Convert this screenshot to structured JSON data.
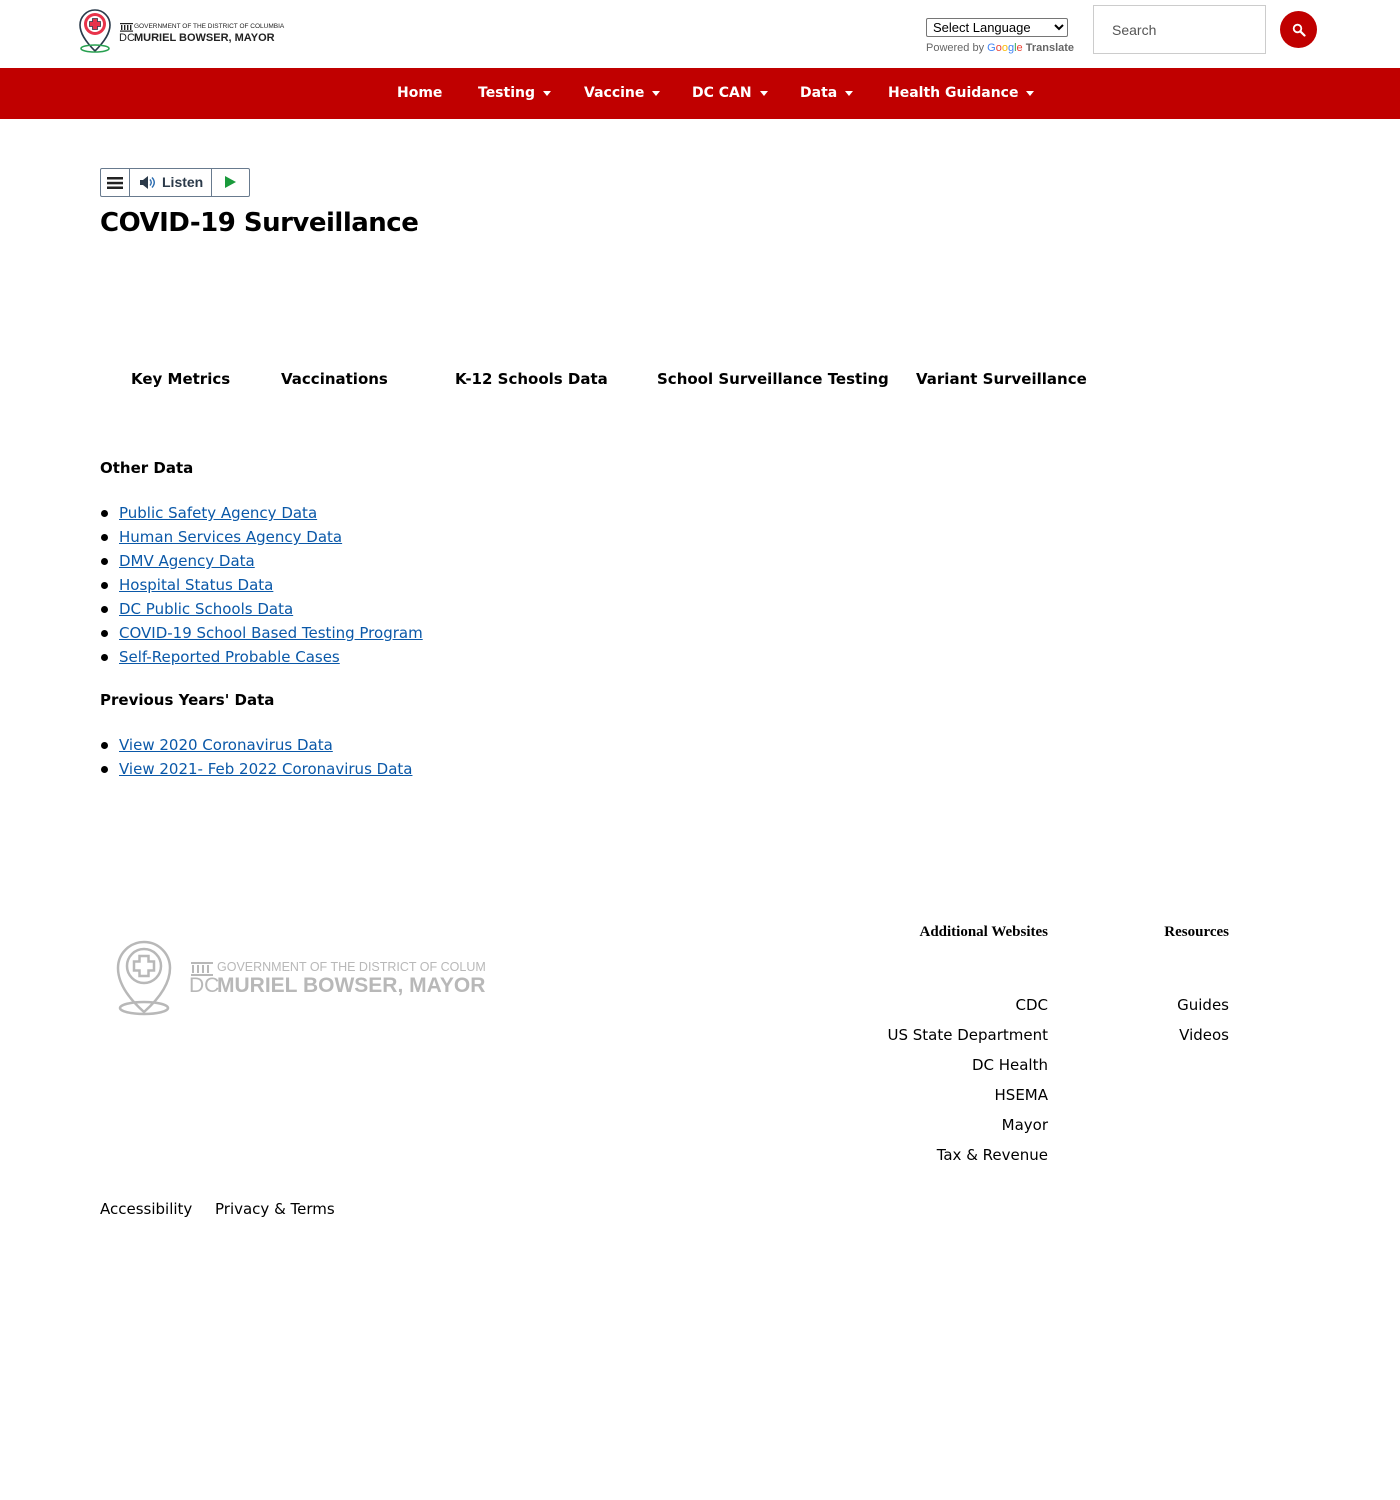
{
  "header": {
    "logo_text_top": "GOVERNMENT OF THE DISTRICT OF COLUMBIA",
    "logo_text_dc": "DC",
    "logo_text_main": "MURIEL BOWSER, MAYOR",
    "language_select": "Select Language",
    "powered_by": "Powered by",
    "google": "Google",
    "translate": "Translate",
    "search_placeholder": "Search"
  },
  "nav": {
    "items": [
      {
        "label": "Home",
        "dropdown": false
      },
      {
        "label": "Testing",
        "dropdown": true
      },
      {
        "label": "Vaccine",
        "dropdown": true
      },
      {
        "label": "DC CAN",
        "dropdown": true
      },
      {
        "label": "Data",
        "dropdown": true
      },
      {
        "label": "Health Guidance",
        "dropdown": true
      }
    ]
  },
  "listen": {
    "label": "Listen"
  },
  "main": {
    "title": "COVID-19 Surveillance",
    "tabs": [
      "Key Metrics",
      "Vaccinations",
      "K-12 Schools Data",
      "School Surveillance Testing",
      "Variant Surveillance"
    ],
    "other_data_heading": "Other Data",
    "other_data_links": [
      "Public Safety Agency Data",
      "Human Services Agency Data",
      "DMV Agency Data",
      "Hospital Status Data",
      "DC Public Schools Data",
      "COVID-19 School Based Testing Program",
      "Self-Reported Probable Cases"
    ],
    "previous_heading": "Previous Years' Data",
    "previous_links": [
      "View 2020 Coronavirus Data",
      "View 2021- Feb 2022 Coronavirus Data"
    ]
  },
  "footer": {
    "logo_text_top": "GOVERNMENT OF THE DISTRICT OF COLUMBIA",
    "logo_text_dc": "DC",
    "logo_text_main": "MURIEL BOWSER, MAYOR",
    "additional_title": "Additional Websites",
    "additional_links": [
      "CDC",
      "US State Department",
      "DC Health",
      "HSEMA",
      "Mayor",
      "Tax & Revenue"
    ],
    "resources_title": "Resources",
    "resources_links": [
      "Guides",
      "Videos"
    ],
    "legal": {
      "accessibility": "Accessibility",
      "privacy": "Privacy & Terms"
    }
  },
  "colors": {
    "brand_red": "#c00000",
    "link_blue": "#0a58a8"
  }
}
